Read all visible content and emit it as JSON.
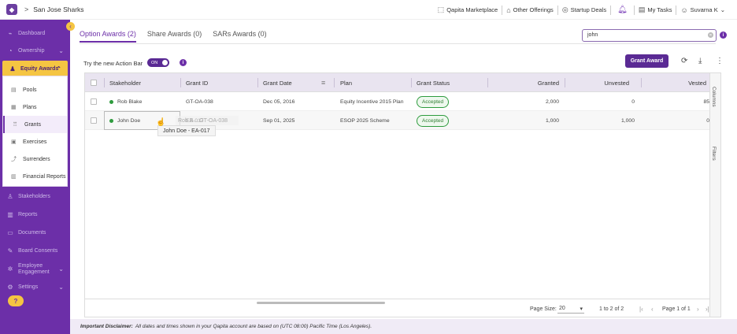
{
  "header": {
    "company": "San Jose Sharks",
    "breadcrumb_sep": ">",
    "links": [
      "Qapita Marketplace",
      "Other Offerings",
      "Startup Deals"
    ],
    "my_tasks": "My Tasks",
    "user": "Suvarna K"
  },
  "sidebar": {
    "items": [
      {
        "label": "Dashboard",
        "icon": "dashboard-icon"
      },
      {
        "label": "Ownership",
        "icon": "ownership-icon"
      },
      {
        "label": "Equity Awards",
        "icon": "equity-awards-icon"
      },
      {
        "label": "Stakeholders",
        "icon": "stakeholders-icon"
      },
      {
        "label": "Reports",
        "icon": "reports-icon"
      },
      {
        "label": "Documents",
        "icon": "documents-icon"
      },
      {
        "label": "Board Consents",
        "icon": "board-consents-icon"
      },
      {
        "label": "Employee Engagement",
        "icon": "engagement-icon"
      },
      {
        "label": "Settings",
        "icon": "settings-icon"
      }
    ],
    "submenu": [
      "Pools",
      "Plans",
      "Grants",
      "Exercises",
      "Surrenders",
      "Financial Reports"
    ],
    "help": "?"
  },
  "tabs": [
    "Option Awards (2)",
    "Share Awards (0)",
    "SARs Awards (0)"
  ],
  "search": {
    "value": "john"
  },
  "action_bar": {
    "label": "Try the new Action Bar",
    "toggle": "ON"
  },
  "grant_award": "Grant Award",
  "table": {
    "columns": [
      "Stakeholder",
      "Grant ID",
      "Grant Date",
      "Plan",
      "Grant Status",
      "Granted",
      "Unvested",
      "Vested"
    ],
    "rows": [
      {
        "stakeholder": "Rob Blake",
        "grant_id": "GT-OA-038",
        "grant_date": "Dec 05, 2016",
        "plan": "Equity Incentive 2015 Plan",
        "status": "Accepted",
        "granted": "2,000",
        "unvested": "0",
        "vested": "85"
      },
      {
        "stakeholder": "John Doe",
        "grant_id": "EA-017",
        "grant_date": "Sep 01, 2025",
        "plan": "ESOP 2025 Scheme",
        "status": "Accepted",
        "granted": "1,000",
        "unvested": "1,000",
        "vested": "0"
      }
    ],
    "drag_ghost": "Rob B... GT-OA-038",
    "tooltip": "John Doe - EA-017"
  },
  "side_labels": {
    "columns": "Columns",
    "filters": "Filters"
  },
  "footer": {
    "page_size_label": "Page Size:",
    "page_size": "20",
    "range": "1 to 2 of 2",
    "page": "Page 1 of 1"
  },
  "disclaimer": {
    "title": "Important Disclaimer:",
    "text": "All dates and times shown in your Qapita account are based on (UTC 08:00) Pacific Time (Los Angeles)."
  }
}
